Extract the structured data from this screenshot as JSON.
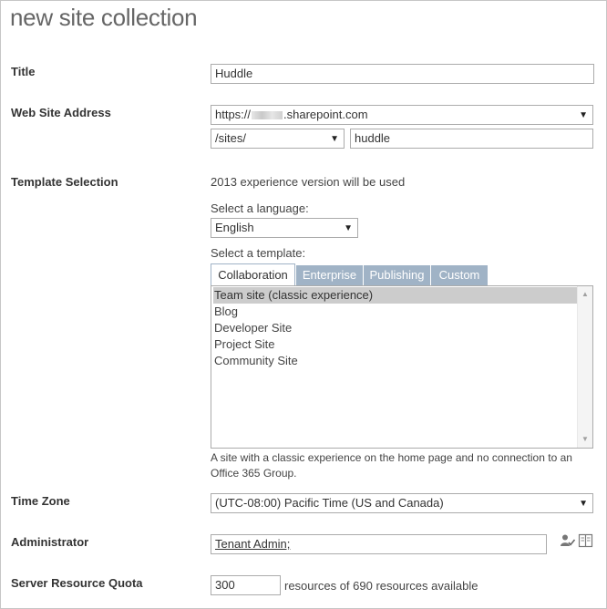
{
  "page": {
    "title": "new site collection"
  },
  "title_field": {
    "label": "Title",
    "value": "Huddle"
  },
  "web_address": {
    "label": "Web Site Address",
    "domain_prefix": "https://",
    "domain_suffix": ".sharepoint.com",
    "path_select": "/sites/",
    "path_value": "huddle"
  },
  "template": {
    "label": "Template Selection",
    "experience_note": "2013 experience version will be used",
    "language_label": "Select a language:",
    "language_value": "English",
    "template_label": "Select a template:",
    "tabs": [
      "Collaboration",
      "Enterprise",
      "Publishing",
      "Custom"
    ],
    "active_tab": "Collaboration",
    "items": [
      "Team site (classic experience)",
      "Blog",
      "Developer Site",
      "Project Site",
      "Community Site"
    ],
    "selected_item": "Team site (classic experience)",
    "description": "A site with a classic experience on the home page and no connection to an Office 365 Group."
  },
  "time_zone": {
    "label": "Time Zone",
    "value": "(UTC-08:00) Pacific Time (US and Canada)"
  },
  "administrator": {
    "label": "Administrator",
    "value": "Tenant Admin;",
    "check_names_icon": "person-check-icon",
    "browse_icon": "address-book-icon"
  },
  "quota": {
    "label": "Server Resource Quota",
    "value": "300",
    "suffix": "resources of 690 resources available"
  }
}
